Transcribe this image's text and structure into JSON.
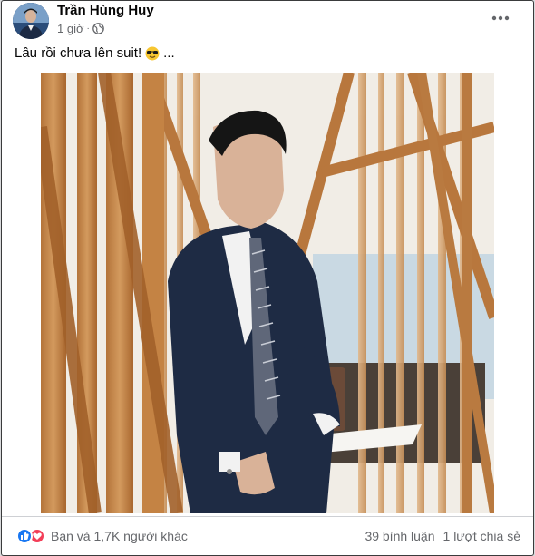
{
  "post": {
    "author": "Trần Hùng Huy",
    "time": "1 giờ",
    "separator": "·",
    "audience_icon": "globe-icon",
    "more_icon": "more-horizontal-icon",
    "caption": "Lâu rồi chưa lên suit!",
    "caption_emoji": "sunglasses-emoji",
    "caption_ellipsis": "...",
    "photo": "man-in-navy-suit-leaning-on-table-behind-wooden-slats"
  },
  "footer": {
    "reaction_icons": [
      "like-icon",
      "love-icon"
    ],
    "reactions_text": "Bạn và 1,7K người khác",
    "comments": "39 bình luận",
    "shares": "1 lượt chia sẻ"
  },
  "colors": {
    "brand_blue": "#1877f2",
    "love_red": "#f33e58",
    "secondary_text": "#65676b",
    "border": "#ced0d4"
  }
}
